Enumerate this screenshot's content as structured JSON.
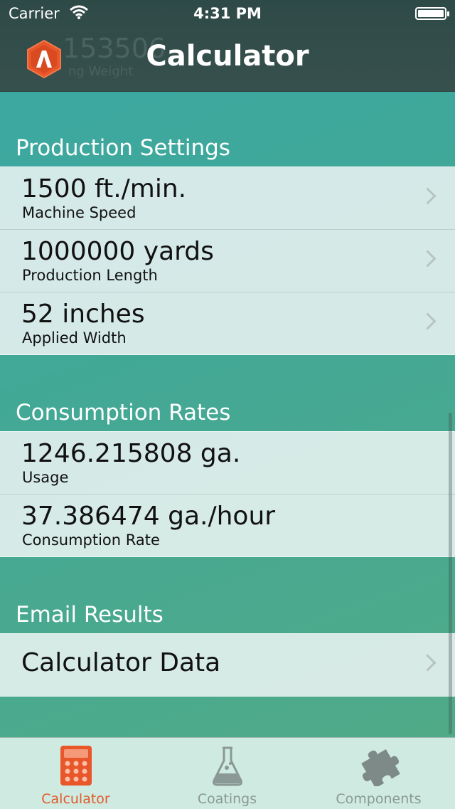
{
  "status_bar": {
    "carrier": "Carrier",
    "time": "4:31 PM"
  },
  "header": {
    "title": "Calculator",
    "ghost_value": "153506",
    "ghost_label": "ng Weight"
  },
  "sections": [
    {
      "title": "Production Settings",
      "rows": [
        {
          "value": "1500 ft./min.",
          "label": "Machine Speed"
        },
        {
          "value": "1000000 yards",
          "label": "Production Length"
        },
        {
          "value": "52 inches",
          "label": "Applied Width"
        }
      ]
    },
    {
      "title": "Consumption Rates",
      "rows": [
        {
          "value": "1246.215808 ga.",
          "label": "Usage"
        },
        {
          "value": "37.386474 ga./hour",
          "label": "Consumption Rate"
        }
      ]
    },
    {
      "title": "Email Results",
      "rows": [
        {
          "value": "Calculator Data"
        }
      ]
    }
  ],
  "tabs": [
    {
      "label": "Calculator",
      "icon": "calculator-icon",
      "active": true
    },
    {
      "label": "Coatings",
      "icon": "flask-icon",
      "active": false
    },
    {
      "label": "Components",
      "icon": "puzzle-icon",
      "active": false
    }
  ],
  "colors": {
    "accent": "#e05a2a",
    "header": "#2e4a47",
    "background": "#43a895"
  }
}
